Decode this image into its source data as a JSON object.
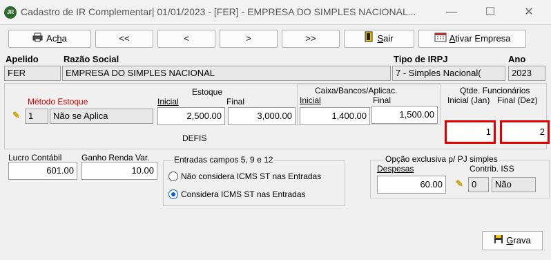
{
  "window": {
    "title": "Cadastro de IR Complementar|  01/01/2023 - [FER] - EMPRESA DO SIMPLES NACIONAL...",
    "app_icon_text": "JR",
    "minimize": "—",
    "maximize": "☐",
    "close": "✕"
  },
  "toolbar": {
    "find_label_pre": "Ac",
    "find_label_u": "h",
    "find_label_post": "a",
    "first_label": "<<",
    "prev_label": "<",
    "next_label": ">",
    "last_label": ">>",
    "exit_label_u": "S",
    "exit_label_post": "air",
    "activate_label_u": "A",
    "activate_label_post": "tivar Empresa"
  },
  "header": {
    "apelido_label": "Apelido",
    "razao_label": "Razão Social",
    "tipo_label": "Tipo de IRPJ",
    "ano_label": "Ano",
    "apelido_value": "FER",
    "razao_value": "EMPRESA DO SIMPLES NACIONAL",
    "tipo_value": "7 - Simples Nacional(",
    "ano_value": "2023"
  },
  "stock": {
    "metodo_label": "Método Estoque",
    "metodo_code": "1",
    "metodo_value": "Não se Aplica",
    "estoque_label": "Estoque",
    "inicial_label": "Inicial",
    "final_label": "Final",
    "estoque_inicial": "2,500.00",
    "estoque_final": "3,000.00",
    "caixa_label": "Caixa/Bancos/Aplicac.",
    "caixa_inicial_label": "Inicial",
    "caixa_final_label": "Final",
    "caixa_inicial": "1,400.00",
    "caixa_final": "1,500.00",
    "func_label": "Qtde. Funcionários",
    "func_inicial_label": "Inicial (Jan)",
    "func_final_label": "Final (Dez)",
    "func_inicial": "1",
    "func_final": "2"
  },
  "defis": {
    "title": "DEFIS",
    "lucro_label": "Lucro Contábil",
    "lucro_value": "601.00",
    "ganho_label": "Ganho Renda Var.",
    "ganho_value": "10.00",
    "entradas_label": "Entradas campos 5, 9 e 12",
    "radio1_label": "Não considera ICMS ST nas Entradas",
    "radio2_label": "Considera ICMS ST nas Entradas",
    "selected": "radio2"
  },
  "simples": {
    "title": "Opção exclusiva p/ PJ simples",
    "despesas_label": "Despesas",
    "despesas_value": "60.00",
    "contrib_label": "Contrib. ISS",
    "contrib_code": "0",
    "contrib_value": "Não"
  },
  "footer": {
    "save_label_u": "G",
    "save_label_post": "rava"
  },
  "colors": {
    "highlight": "#e00000",
    "required_label": "#d40000",
    "radio_selected": "#0a5fc2"
  }
}
